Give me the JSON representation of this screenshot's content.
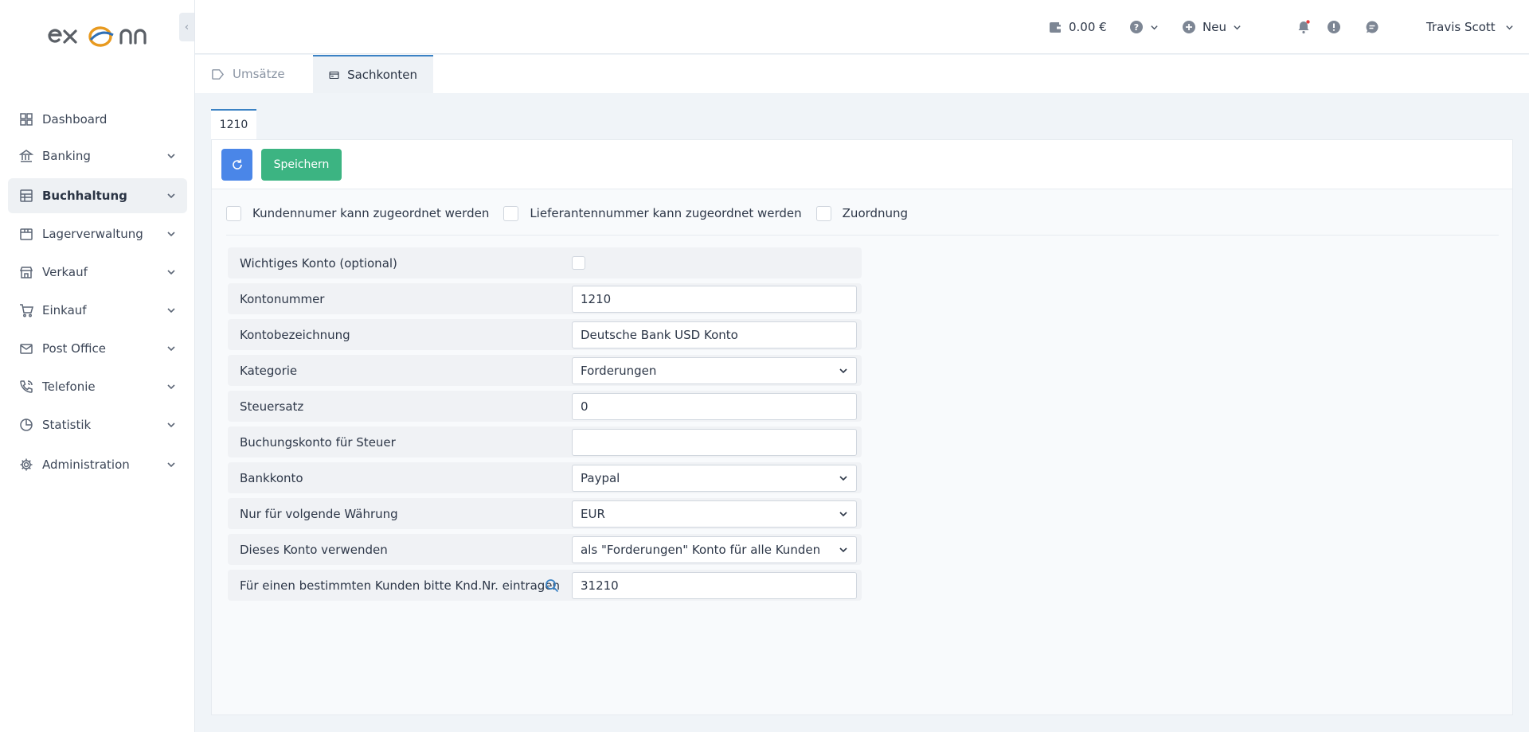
{
  "header": {
    "balance": "0.00 €",
    "new_label": "Neu",
    "user_name": "Travis Scott"
  },
  "sidebar": {
    "items": [
      {
        "label": "Dashboard"
      },
      {
        "label": "Banking"
      },
      {
        "label": "Buchhaltung"
      },
      {
        "label": "Lagerverwaltung"
      },
      {
        "label": "Verkauf"
      },
      {
        "label": "Einkauf"
      },
      {
        "label": "Post Office"
      },
      {
        "label": "Telefonie"
      },
      {
        "label": "Statistik"
      },
      {
        "label": "Administration"
      }
    ]
  },
  "tabs": [
    {
      "label": "Umsätze"
    },
    {
      "label": "Sachkonten"
    }
  ],
  "subtab": {
    "label": "1210"
  },
  "toolbar": {
    "save_label": "Speichern"
  },
  "checkboxes": [
    {
      "label": "Kundennumer kann zugeordnet werden"
    },
    {
      "label": "Lieferantennummer kann zugeordnet werden"
    },
    {
      "label": "Zuordnung"
    }
  ],
  "form": {
    "important": {
      "label": "Wichtiges Konto (optional)"
    },
    "account_number": {
      "label": "Kontonummer",
      "value": "1210"
    },
    "account_name": {
      "label": "Kontobezeichnung",
      "value": "Deutsche Bank USD Konto"
    },
    "category": {
      "label": "Kategorie",
      "value": "Forderungen"
    },
    "tax_rate": {
      "label": "Steuersatz",
      "value": "0"
    },
    "tax_account": {
      "label": "Buchungskonto für Steuer",
      "value": ""
    },
    "bank_account": {
      "label": "Bankkonto",
      "value": "Paypal"
    },
    "currency": {
      "label": "Nur für volgende Währung",
      "value": "EUR"
    },
    "usage": {
      "label": "Dieses Konto verwenden",
      "value": "als \"Forderungen\" Konto für alle Kunden"
    },
    "customer_no": {
      "label": "Für einen bestimmten Kunden bitte Knd.Nr. eintragen",
      "value": "31210"
    }
  },
  "colors": {
    "accent": "#3b82c4",
    "primary_button": "#4a86e8",
    "save_button": "#3cb482",
    "notification_dot": "#e53e3e"
  }
}
